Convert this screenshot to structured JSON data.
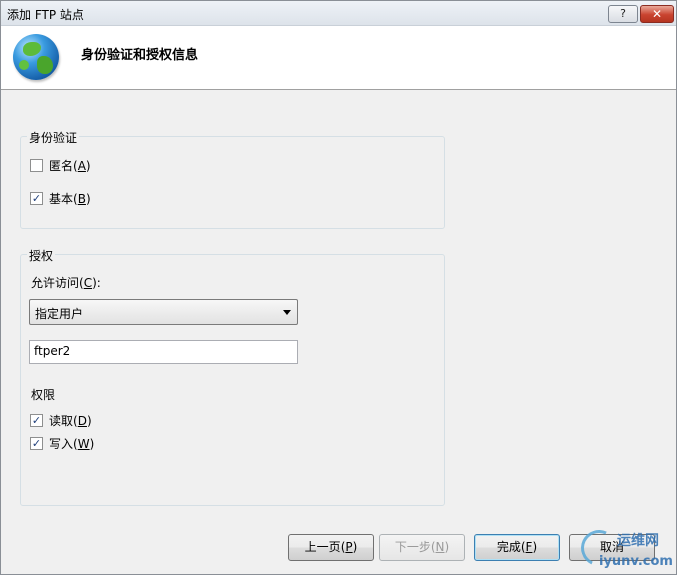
{
  "window": {
    "title": "添加 FTP 站点",
    "help_label": "?",
    "close_label": "✕"
  },
  "header": {
    "title": "身份验证和授权信息",
    "icon": "globe-icon"
  },
  "authentication": {
    "group_label": "身份验证",
    "anonymous": {
      "label": "匿名",
      "accel": "A",
      "checked": false
    },
    "basic": {
      "label": "基本",
      "accel": "B",
      "checked": true
    }
  },
  "authorization": {
    "group_label": "授权",
    "allow_access_label": "允许访问",
    "allow_access_accel": "C",
    "allow_access_value": "指定用户",
    "users_value": "ftper2",
    "permissions_label": "权限",
    "read": {
      "label": "读取",
      "accel": "D",
      "checked": true
    },
    "write": {
      "label": "写入",
      "accel": "W",
      "checked": true
    }
  },
  "buttons": {
    "previous": {
      "label": "上一页",
      "accel": "P"
    },
    "next": {
      "label": "下一步",
      "accel": "N"
    },
    "finish": {
      "label": "完成",
      "accel": "F"
    },
    "cancel": {
      "label": "取消"
    }
  },
  "watermark": {
    "cn": "运维网",
    "en": "iyunv.com"
  }
}
